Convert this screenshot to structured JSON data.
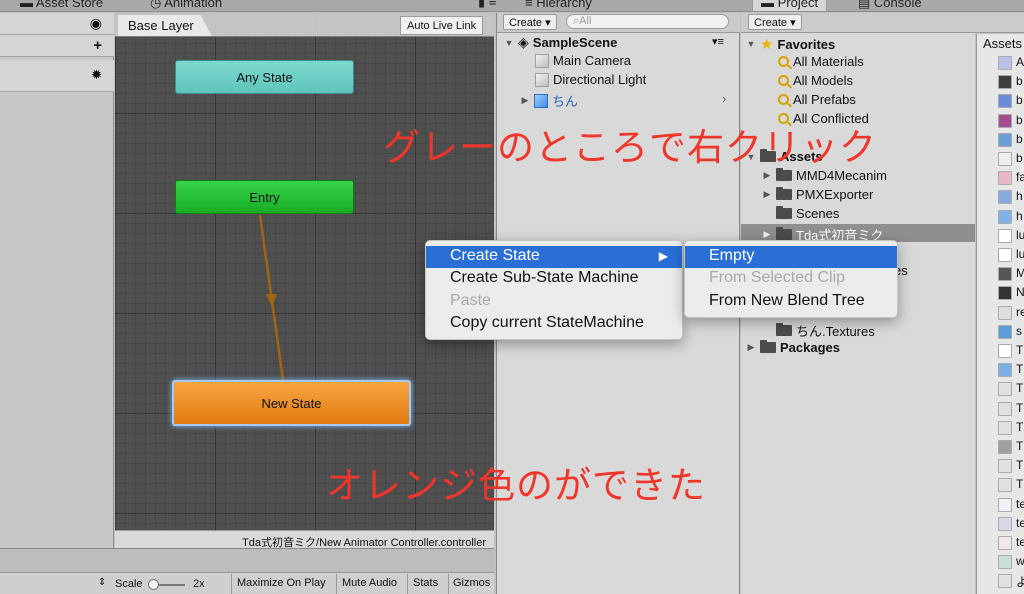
{
  "top_tabs": {
    "asset_store": "Asset Store",
    "animation": "Animation",
    "hierarchy": "Hierarchy",
    "project": "Project",
    "console": "Console"
  },
  "animator": {
    "layer_tab": "Base Layer",
    "auto_live_link": "Auto Live Link",
    "states": {
      "any": "Any State",
      "entry": "Entry",
      "new": "New State"
    },
    "path": "Tda式初音ミク/New Animator Controller.controller",
    "toolbar": {
      "scale_label": "Scale",
      "scale_value": "2x",
      "maximize": "Maximize On Play",
      "mute": "Mute Audio",
      "stats": "Stats",
      "gizmos": "Gizmos"
    }
  },
  "hierarchy": {
    "create": "Create ▾",
    "search_placeholder": "All",
    "scene": "SampleScene",
    "items": [
      "Main Camera",
      "Directional Light",
      "ちん"
    ]
  },
  "project": {
    "create": "Create ▾",
    "favorites": "Favorites",
    "fav_items": [
      "All Materials",
      "All Models",
      "All Prefabs",
      "All Conflicted"
    ],
    "assets": "Assets",
    "folders": [
      "MMD4Mecanim",
      "PMXExporter",
      "Scenes",
      "Tda式初音ミク"
    ],
    "partial_es": "es",
    "textures": "ちん.Textures",
    "packages": "Packages",
    "assets_header": "Assets"
  },
  "asset_list_letters": [
    "A",
    "b",
    "b",
    "b",
    "b",
    "b",
    "fa",
    "h",
    "h",
    "lu",
    "lu",
    "M",
    "N",
    "re",
    "s",
    "T",
    "T",
    "T",
    "T",
    "T",
    "T",
    "T",
    "T",
    "te",
    "te",
    "te",
    "w",
    "よ"
  ],
  "context_menu": {
    "items": [
      "Create State",
      "Create Sub-State Machine",
      "Paste",
      "Copy current StateMachine"
    ],
    "submenu": [
      "Empty",
      "From Selected Clip",
      "From New Blend Tree"
    ]
  },
  "annotations": {
    "right_click": "グレーのところで右クリック",
    "orange_done": "オレンジ色のができた"
  },
  "colors": {
    "accent_menu": "#2a6fd6",
    "annotation": "#f0352b",
    "state_any": "#6fd1c8",
    "state_entry": "#22c033",
    "state_new": "#ef8e28"
  }
}
